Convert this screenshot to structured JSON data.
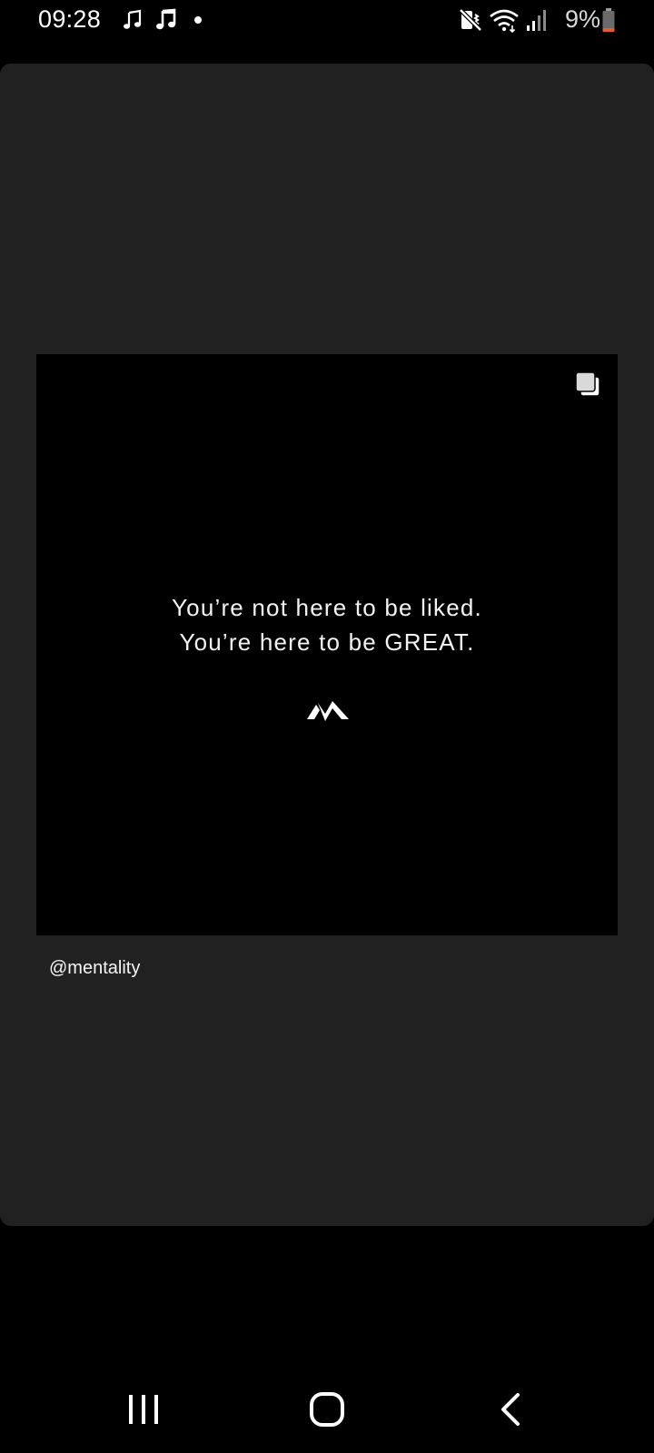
{
  "status_bar": {
    "time": "09:28",
    "notification_icons": [
      "music-note-icon",
      "music-note-icon",
      "dot-icon"
    ],
    "right_icons": [
      "mute-icon",
      "wifi-icon",
      "signal-icon"
    ],
    "battery_percent": "9%",
    "battery_color": "#e35a3c"
  },
  "post": {
    "quote_line_1": "You’re not here to be liked.",
    "quote_line_2": "You’re here to be GREAT.",
    "multi_image_icon": "multiple-images-icon",
    "logo_icon": "mentality-logo-icon",
    "username": "@mentality"
  },
  "nav_bar": {
    "buttons": [
      "recents-icon",
      "home-icon",
      "back-icon"
    ]
  },
  "colors": {
    "background": "#000000",
    "card": "#212121",
    "media": "#000000",
    "text": "#ffffff"
  }
}
